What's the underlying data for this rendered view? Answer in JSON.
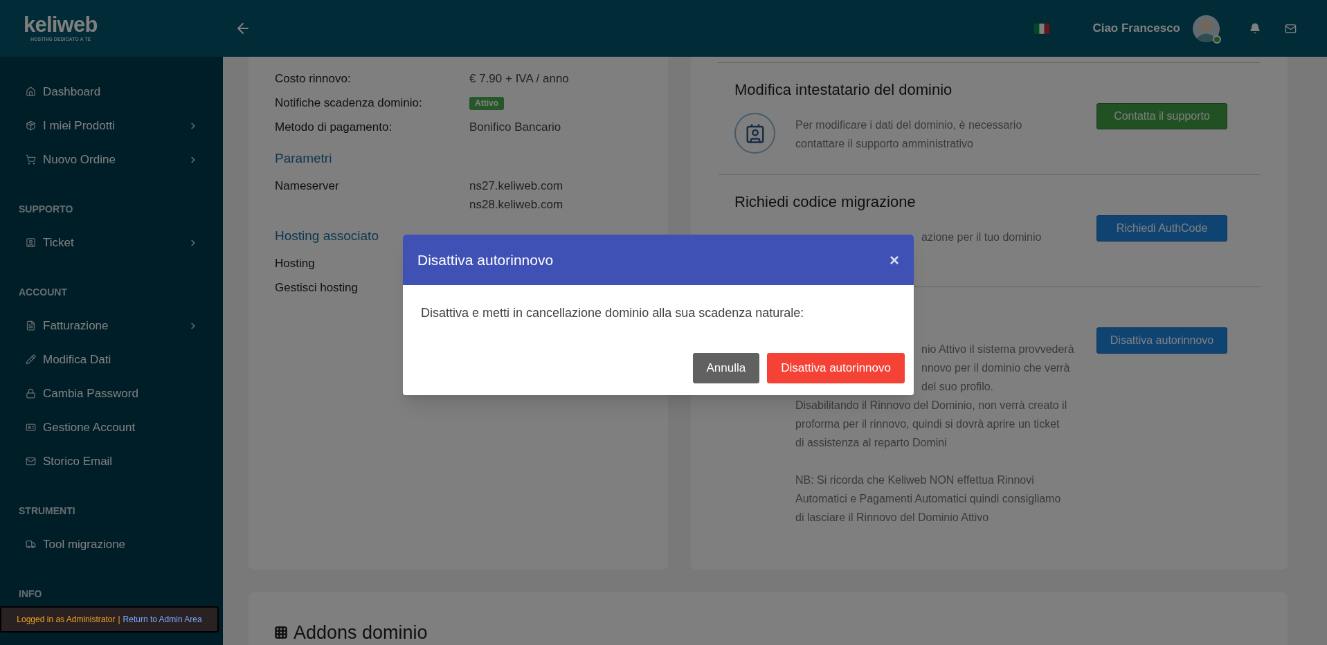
{
  "header": {
    "logo": "keliweb",
    "logo_tagline": "HOSTING DEDICATO A TE",
    "greeting": "Ciao Francesco",
    "user_online": true
  },
  "sidebar": {
    "groups": [
      {
        "items": [
          {
            "label": "Dashboard",
            "has_submenu": false
          },
          {
            "label": "I miei Prodotti",
            "has_submenu": true
          },
          {
            "label": "Nuovo Ordine",
            "has_submenu": true
          }
        ]
      },
      {
        "title": "SUPPORTO",
        "items": [
          {
            "label": "Ticket",
            "has_submenu": true
          }
        ]
      },
      {
        "title": "ACCOUNT",
        "items": [
          {
            "label": "Fatturazione",
            "has_submenu": true
          },
          {
            "label": "Modifica Dati",
            "has_submenu": false
          },
          {
            "label": "Cambia Password",
            "has_submenu": false
          },
          {
            "label": "Gestione Account",
            "has_submenu": false
          },
          {
            "label": "Storico Email",
            "has_submenu": false
          }
        ]
      },
      {
        "title": "STRUMENTI",
        "items": [
          {
            "label": "Tool migrazione",
            "has_submenu": false
          }
        ]
      },
      {
        "title": "INFO"
      }
    ]
  },
  "admin_bar": {
    "text": "Logged in as Administrator",
    "separator": "|",
    "link": "Return to Admin Area"
  },
  "domain_details": {
    "rows": [
      {
        "label": "Costo rinnovo:",
        "values": [
          "€ 7.90 + IVA / anno"
        ]
      },
      {
        "label": "Notifiche scadenza dominio:",
        "badge": "Attivo"
      },
      {
        "label": "Metodo di pagamento:",
        "values": [
          "Bonifico Bancario"
        ]
      }
    ],
    "sections": [
      {
        "title": "Parametri",
        "rows": [
          {
            "label": "Nameserver",
            "values": [
              "ns27.keliweb.com",
              "ns28.keliweb.com"
            ]
          }
        ]
      },
      {
        "title": "Hosting associato",
        "rows": [
          {
            "label": "Hosting"
          },
          {
            "label": "Gestisci hosting"
          }
        ]
      }
    ]
  },
  "actions": [
    {
      "title": "Modifica intestatario del dominio",
      "lines": [
        {
          "text": "Per modificare i dati del dominio, è necessario",
          "kind": "full"
        },
        {
          "text": "contattare il supporto amministrativo",
          "kind": "full"
        }
      ],
      "button": {
        "label": "Contatta il supporto",
        "kind": "success"
      }
    },
    {
      "title": "Richiedi codice migrazione",
      "lines": [
        {
          "text": "azione per il tuo dominio",
          "kind": "partial"
        }
      ],
      "button": {
        "label": "Richiedi AuthCode",
        "kind": "primary"
      }
    },
    {
      "lines": [
        {
          "text": "nio Attivo il sistema provvederà",
          "kind": "partial"
        },
        {
          "text": "nnovo per il dominio che verrà",
          "kind": "partial"
        },
        {
          "text": "del suo profilo.",
          "kind": "partial"
        },
        {
          "text": "Disabilitando il Rinnovo del Dominio, non verrà creato il",
          "kind": "full"
        },
        {
          "text": "proforma per il rinnovo, quindi si dovrà aprire un ticket",
          "kind": "full"
        },
        {
          "text": "di assistenza al reparto Domini",
          "kind": "full"
        },
        {
          "kind": "blank"
        },
        {
          "text": "NB: Si ricorda che Keliweb NON effettua Rinnovi",
          "kind": "full"
        },
        {
          "text": "Automatici e Pagamenti Automatici quindi consigliamo",
          "kind": "full"
        },
        {
          "text": "di lasciare il Rinnovo del Dominio Attivo",
          "kind": "full"
        }
      ],
      "button": {
        "label": "Disattiva autorinnovo",
        "kind": "primary"
      }
    }
  ],
  "addons": {
    "title": "Addons dominio"
  },
  "modal": {
    "title": "Disattiva autorinnovo",
    "close": "×",
    "message": "Disattiva e metti in cancellazione dominio alla sua scadenza naturale:",
    "buttons": [
      {
        "label": "Annulla",
        "kind": "secondary"
      },
      {
        "label": "Disattiva autorinnovo",
        "kind": "danger"
      }
    ]
  }
}
